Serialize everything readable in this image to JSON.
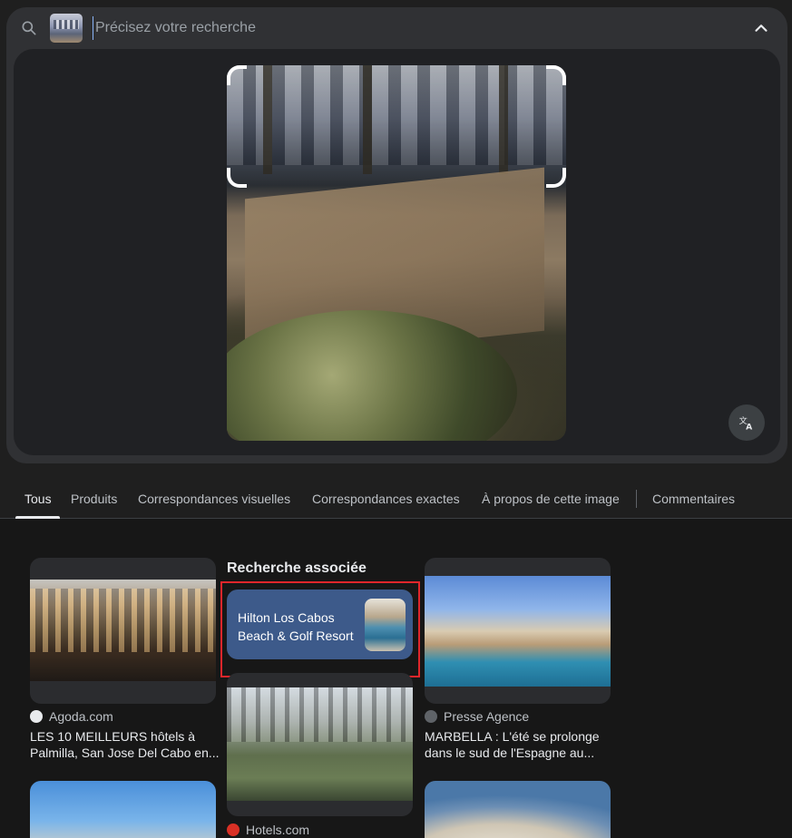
{
  "search": {
    "placeholder": "Précisez votre recherche",
    "value": "",
    "icon": "search-icon",
    "collapse_icon": "chevron-up-icon"
  },
  "image_preview": {
    "translate_icon": "translate-icon"
  },
  "tabs": [
    {
      "label": "Tous",
      "active": true
    },
    {
      "label": "Produits",
      "active": false
    },
    {
      "label": "Correspondances visuelles",
      "active": false
    },
    {
      "label": "Correspondances exactes",
      "active": false
    },
    {
      "label": "À propos de cette image",
      "active": false
    },
    {
      "label": "Commentaires",
      "active": false
    }
  ],
  "results": {
    "col1": [
      {
        "source": "Agoda.com",
        "caption": "LES 10 MEILLEURS hôtels à Palmilla, San Jose Del Cabo en..."
      }
    ],
    "col2": {
      "related_title": "Recherche associée",
      "related_label": "Hilton Los Cabos Beach & Golf Resort",
      "result": {
        "source": "Hotels.com"
      }
    },
    "col3": [
      {
        "source": "Presse Agence",
        "caption": "MARBELLA : L'été se prolonge dans le sud de l'Espagne au..."
      }
    ]
  },
  "colors": {
    "related_card": "#3d5a8a",
    "highlight": "#e0262b",
    "accent": "#8ab4f8"
  }
}
